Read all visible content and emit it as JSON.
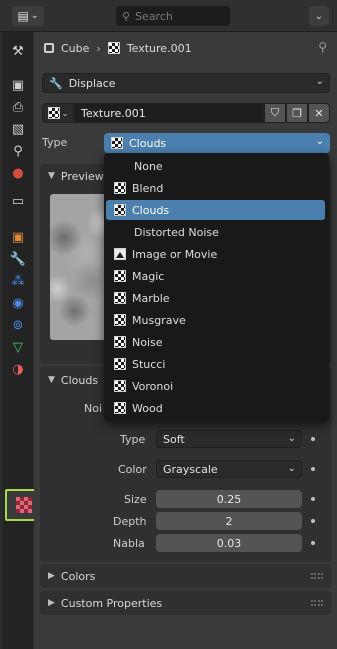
{
  "topbar": {
    "editor_icon": "editor-type-icon",
    "search_placeholder": "Search"
  },
  "breadcrumb": {
    "object": "Cube",
    "texture": "Texture.001"
  },
  "modifier": {
    "value": "Displace"
  },
  "texture": {
    "name": "Texture.001"
  },
  "type_field": {
    "label": "Type",
    "value": "Clouds"
  },
  "sections": {
    "preview": "Preview",
    "clouds": "Clouds",
    "noise_partial": "Noi",
    "colors": "Colors",
    "custom_properties": "Custom Properties"
  },
  "clouds_settings": {
    "type_label": "Type",
    "type_value": "Soft",
    "color_label": "Color",
    "color_value": "Grayscale",
    "size_label": "Size",
    "size_value": "0.25",
    "depth_label": "Depth",
    "depth_value": "2",
    "nabla_label": "Nabla",
    "nabla_value": "0.03"
  },
  "type_menu": {
    "selected": "Clouds",
    "items": [
      "None",
      "Blend",
      "Clouds",
      "Distorted Noise",
      "Image or Movie",
      "Magic",
      "Marble",
      "Musgrave",
      "Noise",
      "Stucci",
      "Voronoi",
      "Wood"
    ]
  },
  "colors": {
    "selection": "#4a7fae",
    "active_tab_outline": "#a8d94a"
  }
}
